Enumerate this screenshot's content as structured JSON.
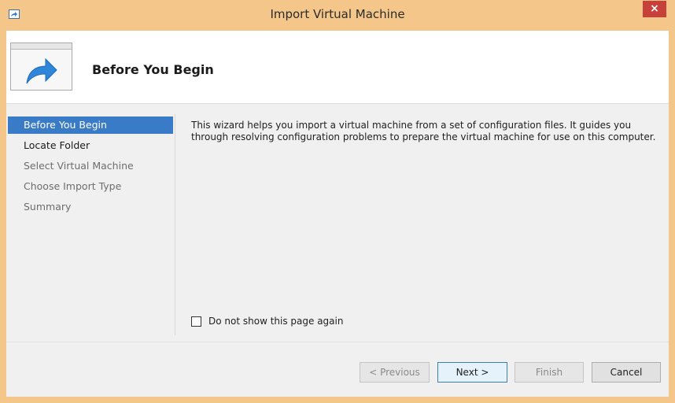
{
  "window": {
    "title": "Import Virtual Machine",
    "close_glyph": "×",
    "accent_color": "#f4c68a",
    "close_color": "#c7413a"
  },
  "icons": {
    "app_icon": "import-arrow-icon",
    "header_icon": "import-vm-wizard-icon"
  },
  "header": {
    "title": "Before You Begin"
  },
  "nav": {
    "items": [
      {
        "label": "Before You Begin",
        "state": "active"
      },
      {
        "label": "Locate Folder",
        "state": "enabled"
      },
      {
        "label": "Select Virtual Machine",
        "state": "disabled"
      },
      {
        "label": "Choose Import Type",
        "state": "disabled"
      },
      {
        "label": "Summary",
        "state": "disabled"
      }
    ],
    "active_color": "#3a7bc8"
  },
  "content": {
    "description": "This wizard helps you import a virtual machine from a set of configuration files. It guides you through resolving configuration problems to prepare the virtual machine for use on this computer.",
    "checkbox": {
      "label": "Do not show this page again",
      "checked": false
    }
  },
  "buttons": {
    "previous": {
      "label": "< Previous",
      "enabled": false
    },
    "next": {
      "label": "Next >",
      "enabled": true
    },
    "finish": {
      "label": "Finish",
      "enabled": false
    },
    "cancel": {
      "label": "Cancel",
      "enabled": true
    }
  }
}
